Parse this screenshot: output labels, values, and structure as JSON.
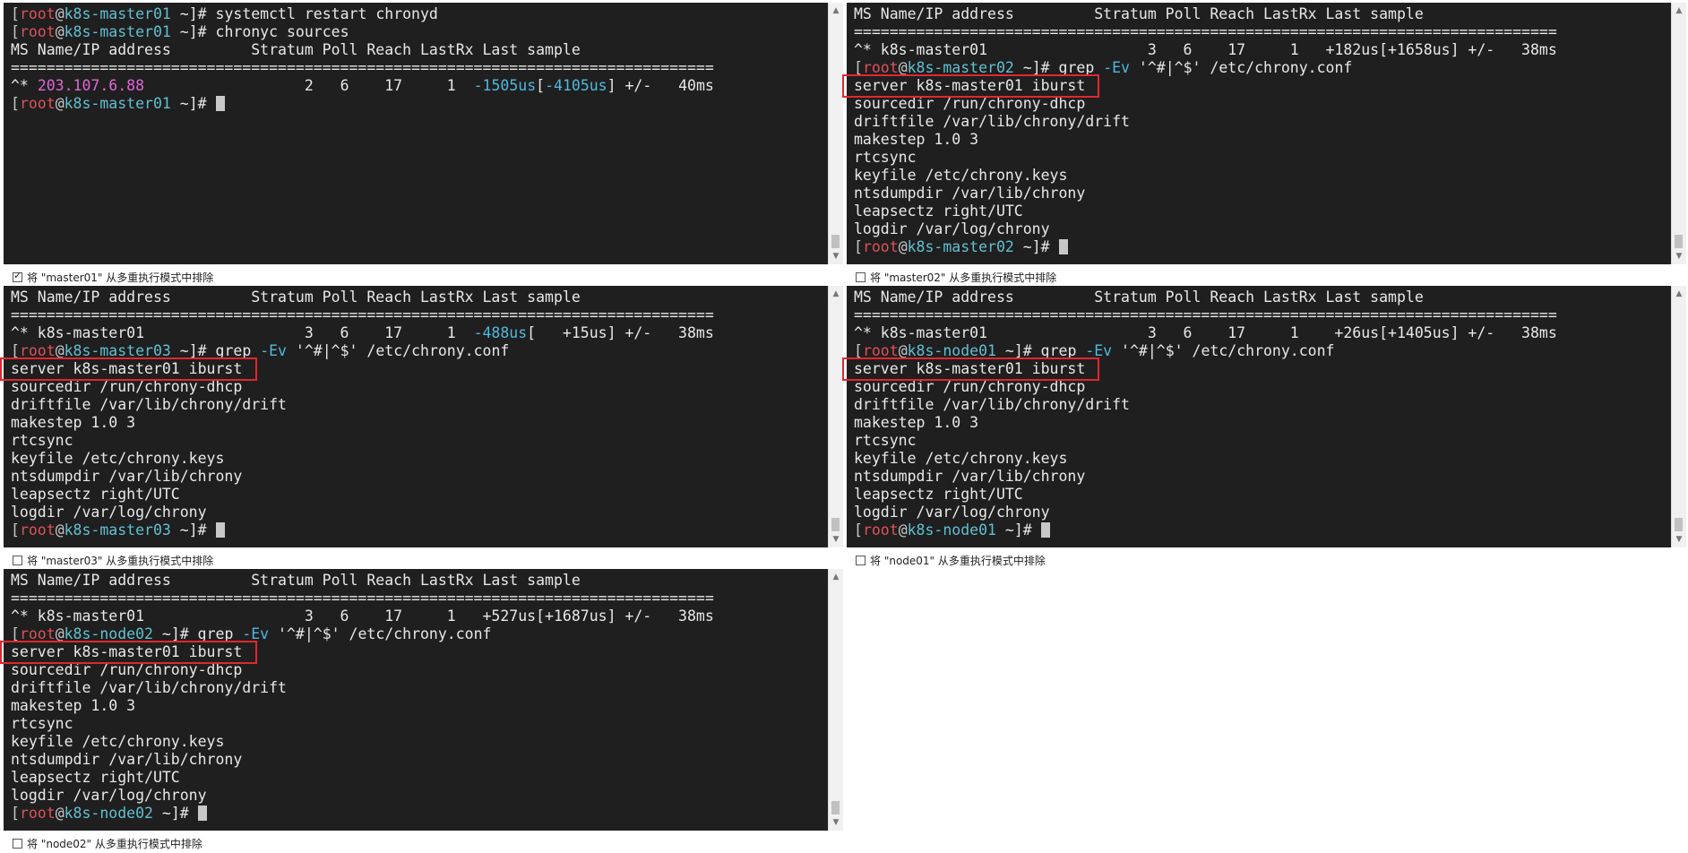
{
  "colors": {
    "terminal_bg": "#1f1f1f",
    "text": "#e8e8e8",
    "user": "#e0505a",
    "host": "#5fc1d2",
    "ip": "#e066d6",
    "offset": "#4fb8e0",
    "highlight": "#e0282e"
  },
  "panes": [
    {
      "id": "master01",
      "lines": [
        [
          [
            "[",
            "brk"
          ],
          [
            "root",
            "user"
          ],
          [
            "@",
            "brk"
          ],
          [
            "k8s-master01",
            "host"
          ],
          [
            " ~]# systemctl restart chronyd",
            ""
          ]
        ],
        [
          [
            "[",
            "brk"
          ],
          [
            "root",
            "user"
          ],
          [
            "@",
            "brk"
          ],
          [
            "k8s-master01",
            "host"
          ],
          [
            " ~]# chronyc sources",
            ""
          ]
        ],
        [
          [
            "MS Name/IP address         Stratum Poll Reach LastRx Last sample",
            ""
          ]
        ],
        [
          [
            "===============================================================================",
            ""
          ]
        ],
        [
          [
            "^* ",
            ""
          ],
          [
            "203.107.6.88",
            "mag"
          ],
          [
            "                  2   6    17     1  ",
            ""
          ],
          [
            "-1505us",
            "blu"
          ],
          [
            "[",
            ""
          ],
          [
            "-4105us",
            "blu"
          ],
          [
            "] +/-   40ms",
            ""
          ]
        ],
        [
          [
            "[",
            "brk"
          ],
          [
            "root",
            "user"
          ],
          [
            "@",
            "brk"
          ],
          [
            "k8s-master01",
            "host"
          ],
          [
            " ~]# ",
            ""
          ],
          [
            "",
            "cursor"
          ]
        ]
      ],
      "exclude_checkbox": {
        "label": "将 \"master01\" 从多重执行模式中排除",
        "checked": true
      }
    },
    {
      "id": "master02",
      "lines": [
        [
          [
            "MS Name/IP address         Stratum Poll Reach LastRx Last sample",
            ""
          ]
        ],
        [
          [
            "===============================================================================",
            ""
          ]
        ],
        [
          [
            "^* k8s-master01                  3   6    17     1   +182us[+1658us] +/-   38ms",
            ""
          ]
        ],
        [
          [
            "[",
            "brk"
          ],
          [
            "root",
            "user"
          ],
          [
            "@",
            "brk"
          ],
          [
            "k8s-master02",
            "host"
          ],
          [
            " ~]# grep ",
            ""
          ],
          [
            "-Ev",
            "blu"
          ],
          [
            " '^#|^$' /etc/chrony.conf",
            ""
          ]
        ],
        [
          [
            "server k8s-master01 iburst",
            ""
          ]
        ],
        [
          [
            "sourcedir /run/chrony-dhcp",
            ""
          ]
        ],
        [
          [
            "driftfile /var/lib/chrony/drift",
            ""
          ]
        ],
        [
          [
            "makestep 1.0 3",
            ""
          ]
        ],
        [
          [
            "rtcsync",
            ""
          ]
        ],
        [
          [
            "keyfile /etc/chrony.keys",
            ""
          ]
        ],
        [
          [
            "ntsdumpdir /var/lib/chrony",
            ""
          ]
        ],
        [
          [
            "leapsectz right/UTC",
            ""
          ]
        ],
        [
          [
            "logdir /var/log/chrony",
            ""
          ]
        ],
        [
          [
            "[",
            "brk"
          ],
          [
            "root",
            "user"
          ],
          [
            "@",
            "brk"
          ],
          [
            "k8s-master02",
            "host"
          ],
          [
            " ~]# ",
            ""
          ],
          [
            "",
            "cursor"
          ]
        ]
      ],
      "exclude_checkbox": {
        "label": "将 \"master02\" 从多重执行模式中排除",
        "checked": false
      }
    },
    {
      "id": "master03",
      "lines": [
        [
          [
            "MS Name/IP address         Stratum Poll Reach LastRx Last sample",
            ""
          ]
        ],
        [
          [
            "===============================================================================",
            ""
          ]
        ],
        [
          [
            "^* k8s-master01                  3   6    17     1  ",
            ""
          ],
          [
            "-488us",
            "blu"
          ],
          [
            "[   +15us] +/-   38ms",
            ""
          ]
        ],
        [
          [
            "[",
            "brk"
          ],
          [
            "root",
            "user"
          ],
          [
            "@",
            "brk"
          ],
          [
            "k8s-master03",
            "host"
          ],
          [
            " ~]# grep ",
            ""
          ],
          [
            "-Ev",
            "blu"
          ],
          [
            " '^#|^$' /etc/chrony.conf",
            ""
          ]
        ],
        [
          [
            "server k8s-master01 iburst",
            ""
          ]
        ],
        [
          [
            "sourcedir /run/chrony-dhcp",
            ""
          ]
        ],
        [
          [
            "driftfile /var/lib/chrony/drift",
            ""
          ]
        ],
        [
          [
            "makestep 1.0 3",
            ""
          ]
        ],
        [
          [
            "rtcsync",
            ""
          ]
        ],
        [
          [
            "keyfile /etc/chrony.keys",
            ""
          ]
        ],
        [
          [
            "ntsdumpdir /var/lib/chrony",
            ""
          ]
        ],
        [
          [
            "leapsectz right/UTC",
            ""
          ]
        ],
        [
          [
            "logdir /var/log/chrony",
            ""
          ]
        ],
        [
          [
            "[",
            "brk"
          ],
          [
            "root",
            "user"
          ],
          [
            "@",
            "brk"
          ],
          [
            "k8s-master03",
            "host"
          ],
          [
            " ~]# ",
            ""
          ],
          [
            "",
            "cursor"
          ]
        ]
      ],
      "exclude_checkbox": {
        "label": "将 \"master03\" 从多重执行模式中排除",
        "checked": false
      }
    },
    {
      "id": "node01",
      "lines": [
        [
          [
            "MS Name/IP address         Stratum Poll Reach LastRx Last sample",
            ""
          ]
        ],
        [
          [
            "===============================================================================",
            ""
          ]
        ],
        [
          [
            "^* k8s-master01                  3   6    17     1    +26us[+1405us] +/-   38ms",
            ""
          ]
        ],
        [
          [
            "[",
            "brk"
          ],
          [
            "root",
            "user"
          ],
          [
            "@",
            "brk"
          ],
          [
            "k8s-node01",
            "host"
          ],
          [
            " ~]# grep ",
            ""
          ],
          [
            "-Ev",
            "blu"
          ],
          [
            " '^#|^$' /etc/chrony.conf",
            ""
          ]
        ],
        [
          [
            "server k8s-master01 iburst",
            ""
          ]
        ],
        [
          [
            "sourcedir /run/chrony-dhcp",
            ""
          ]
        ],
        [
          [
            "driftfile /var/lib/chrony/drift",
            ""
          ]
        ],
        [
          [
            "makestep 1.0 3",
            ""
          ]
        ],
        [
          [
            "rtcsync",
            ""
          ]
        ],
        [
          [
            "keyfile /etc/chrony.keys",
            ""
          ]
        ],
        [
          [
            "ntsdumpdir /var/lib/chrony",
            ""
          ]
        ],
        [
          [
            "leapsectz right/UTC",
            ""
          ]
        ],
        [
          [
            "logdir /var/log/chrony",
            ""
          ]
        ],
        [
          [
            "[",
            "brk"
          ],
          [
            "root",
            "user"
          ],
          [
            "@",
            "brk"
          ],
          [
            "k8s-node01",
            "host"
          ],
          [
            " ~]# ",
            ""
          ],
          [
            "",
            "cursor"
          ]
        ]
      ],
      "exclude_checkbox": {
        "label": "将 \"node01\" 从多重执行模式中排除",
        "checked": false
      }
    },
    {
      "id": "node02",
      "lines": [
        [
          [
            "MS Name/IP address         Stratum Poll Reach LastRx Last sample",
            ""
          ]
        ],
        [
          [
            "===============================================================================",
            ""
          ]
        ],
        [
          [
            "^* k8s-master01                  3   6    17     1   +527us[+1687us] +/-   38ms",
            ""
          ]
        ],
        [
          [
            "[",
            "brk"
          ],
          [
            "root",
            "user"
          ],
          [
            "@",
            "brk"
          ],
          [
            "k8s-node02",
            "host"
          ],
          [
            " ~]# grep ",
            ""
          ],
          [
            "-Ev",
            "blu"
          ],
          [
            " '^#|^$' /etc/chrony.conf",
            ""
          ]
        ],
        [
          [
            "server k8s-master01 iburst",
            ""
          ]
        ],
        [
          [
            "sourcedir /run/chrony-dhcp",
            ""
          ]
        ],
        [
          [
            "driftfile /var/lib/chrony/drift",
            ""
          ]
        ],
        [
          [
            "makestep 1.0 3",
            ""
          ]
        ],
        [
          [
            "rtcsync",
            ""
          ]
        ],
        [
          [
            "keyfile /etc/chrony.keys",
            ""
          ]
        ],
        [
          [
            "ntsdumpdir /var/lib/chrony",
            ""
          ]
        ],
        [
          [
            "leapsectz right/UTC",
            ""
          ]
        ],
        [
          [
            "logdir /var/log/chrony",
            ""
          ]
        ],
        [
          [
            "[",
            "brk"
          ],
          [
            "root",
            "user"
          ],
          [
            "@",
            "brk"
          ],
          [
            "k8s-node02",
            "host"
          ],
          [
            " ~]# ",
            ""
          ],
          [
            "",
            "cursor"
          ]
        ]
      ],
      "exclude_checkbox": {
        "label": "将 \"node02\" 从多重执行模式中排除",
        "checked": false
      }
    }
  ]
}
